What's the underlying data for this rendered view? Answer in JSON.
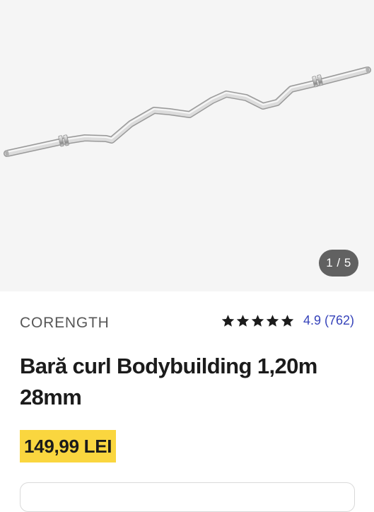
{
  "product": {
    "image_alt": "Curl bar",
    "image_counter": "1 / 5",
    "brand": "CORENGTH",
    "rating": {
      "stars": 5,
      "score": "4.9",
      "count": "(762)"
    },
    "title": "Bară curl Bodybuilding 1,20m 28mm",
    "price": "149,99 LEI"
  },
  "colors": {
    "price_highlight": "#fad63f",
    "rating_link": "#3643ba",
    "counter_bg": "#616161",
    "gallery_bg": "#f5f5f5"
  },
  "icons": [
    "star-icon"
  ]
}
